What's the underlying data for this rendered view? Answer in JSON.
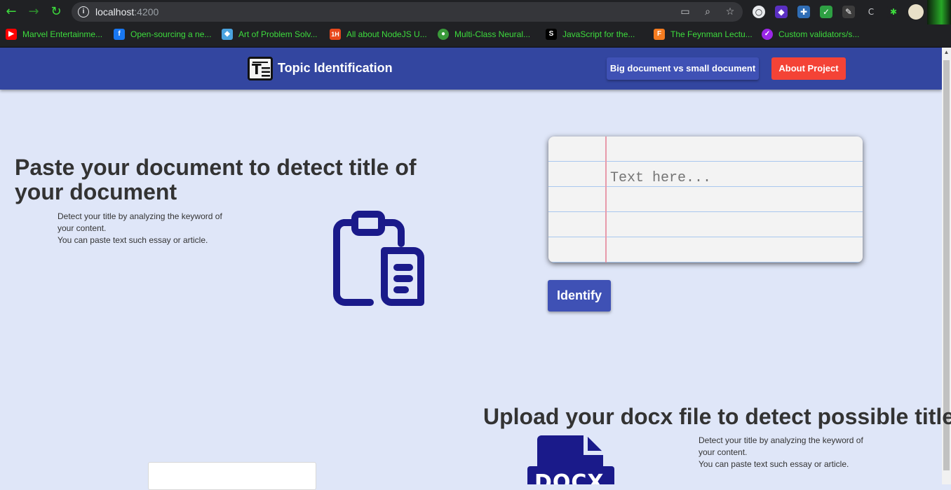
{
  "browser": {
    "url_host": "localhost",
    "url_port": ":4200",
    "bookmarks": [
      {
        "label": "Marvel Entertainme...",
        "icon": "youtube-icon",
        "color": "#ff0000",
        "glyph": "▶"
      },
      {
        "label": "Open-sourcing a ne...",
        "icon": "facebook-icon",
        "color": "#1877f2",
        "glyph": "f"
      },
      {
        "label": "Art of Problem Solv...",
        "icon": "aops-icon",
        "color": "#4aa3df",
        "glyph": "◆"
      },
      {
        "label": "All about NodeJS U...",
        "icon": "1h-icon",
        "color": "#e8481c",
        "glyph": "1H"
      },
      {
        "label": "Multi-Class Neural...",
        "icon": "globe-icon",
        "color": "#3a9a3a",
        "glyph": "●"
      },
      {
        "label": "JavaScript for the...",
        "icon": "s-icon",
        "color": "#000000",
        "glyph": "S"
      },
      {
        "label": "The Feynman Lectu...",
        "icon": "feynman-icon",
        "color": "#f57c20",
        "glyph": "F"
      },
      {
        "label": "Custom validators/s...",
        "icon": "check-icon",
        "color": "#9b27e8",
        "glyph": "✓"
      }
    ]
  },
  "header": {
    "logo_text": "T",
    "title": "Topic Identification",
    "btn_big": "Big document vs small document",
    "btn_about": "About Project"
  },
  "section_paste": {
    "heading": "Paste your document to detect title of your document",
    "desc_line1": "Detect your title by analyzing the keyword of your content.",
    "desc_line2": "You can paste text such essay or article.",
    "placeholder": "Text here...",
    "identify": "Identify"
  },
  "section_upload": {
    "heading": "Upload your docx file to detect possible title",
    "desc_line1": "Detect your title by analyzing the keyword of your content.",
    "desc_line2": "You can paste text such essay or article.",
    "docx_label": "DOCX"
  },
  "colors": {
    "header_bg": "#3346a0",
    "primary": "#3f51b5",
    "accent": "#f44336",
    "icon_navy": "#1a1a8a",
    "page_bg": "#dfe6f8"
  }
}
